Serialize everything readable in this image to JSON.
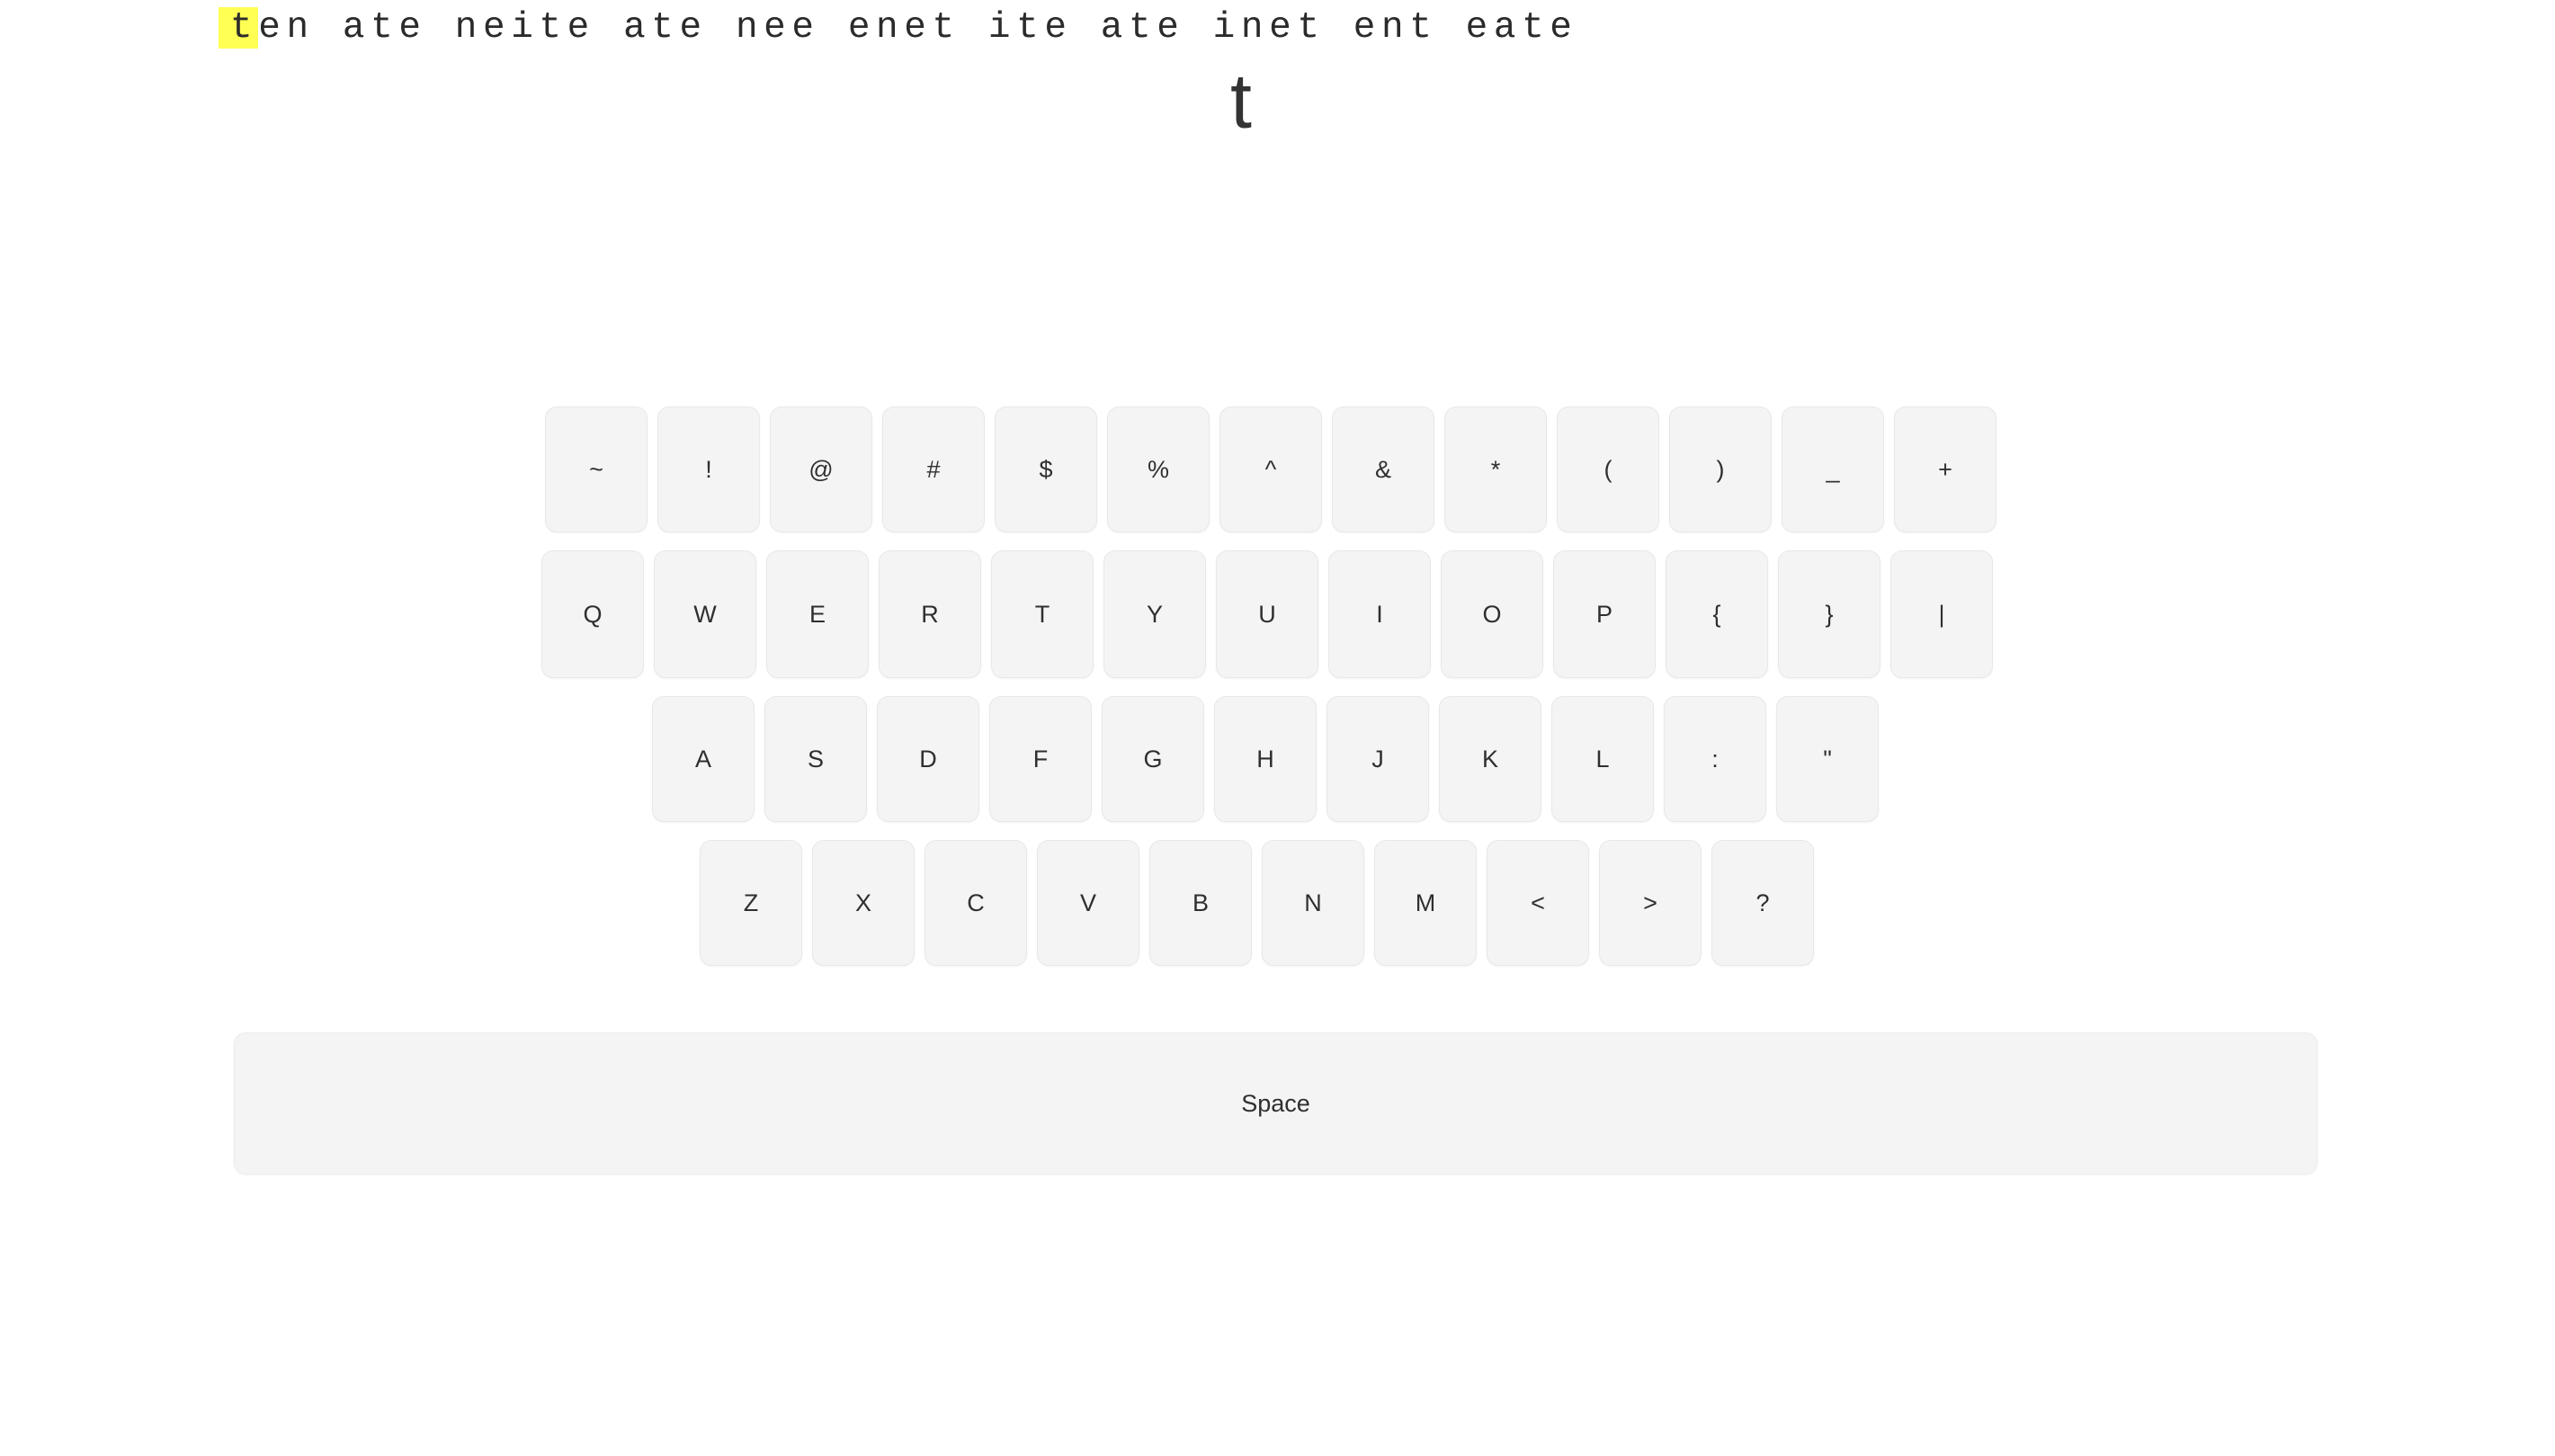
{
  "prompt": {
    "text": "ten ate neite ate nee enet ite ate inet ent eate",
    "active_index": 0,
    "highlight_color": "#ffff54",
    "text_color": "#2b2b2b"
  },
  "target": {
    "character": "t"
  },
  "keyboard": {
    "rows": [
      {
        "name": "symbols-row",
        "keys": [
          "~",
          "!",
          "@",
          "#",
          "$",
          "%",
          "^",
          "&",
          "*",
          "(",
          ")",
          "_",
          "+"
        ]
      },
      {
        "name": "qwerty-row",
        "keys": [
          "Q",
          "W",
          "E",
          "R",
          "T",
          "Y",
          "U",
          "I",
          "O",
          "P",
          "{",
          "}",
          "|"
        ]
      },
      {
        "name": "home-row",
        "keys": [
          "A",
          "S",
          "D",
          "F",
          "G",
          "H",
          "J",
          "K",
          "L",
          ":",
          "\""
        ]
      },
      {
        "name": "bottom-row",
        "keys": [
          "Z",
          "X",
          "C",
          "V",
          "B",
          "N",
          "M",
          "<",
          ">",
          "?"
        ]
      }
    ],
    "space_label": "Space",
    "key_bg": "#f4f4f4",
    "key_border": "#e8e8e8",
    "key_text": "#2f2f2f"
  }
}
